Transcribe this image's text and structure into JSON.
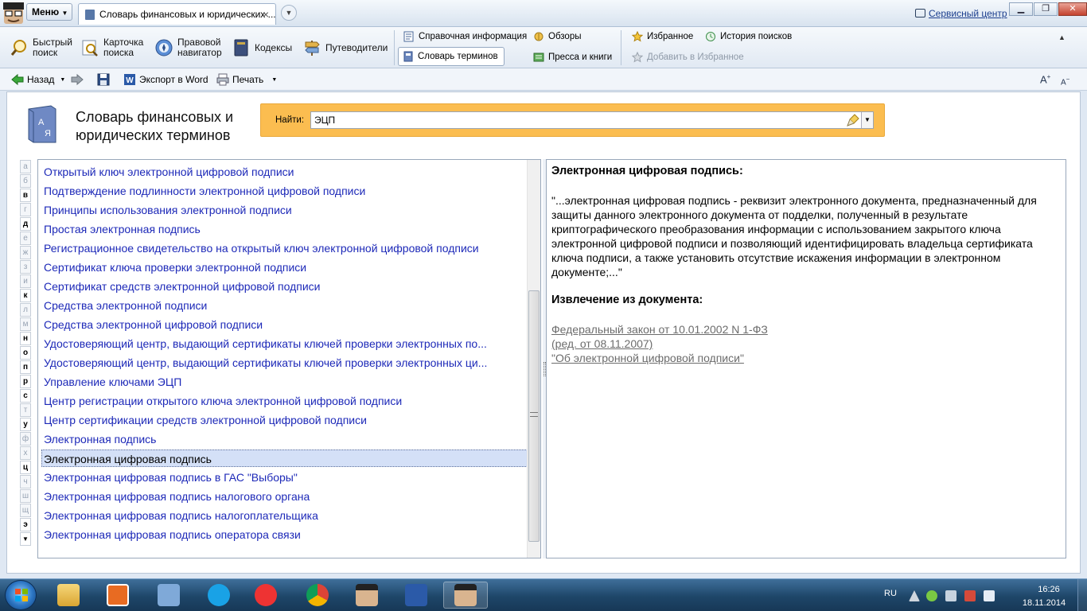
{
  "titlebar": {
    "menu_label": "Меню",
    "tab_title": "Словарь финансовых и юридических ...",
    "service_center": "Сервисный центр"
  },
  "ribbon": {
    "quick_search": "Быстрый\nпоиск",
    "search_card": "Карточка\nпоиска",
    "legal_navigator": "Правовой\nнавигатор",
    "codes": "Кодексы",
    "guides": "Путеводители",
    "reference_info": "Справочная информация",
    "reviews": "Обзоры",
    "dictionary": "Словарь терминов",
    "press_books": "Пресса и книги",
    "favorites": "Избранное",
    "search_history": "История поисков",
    "add_favorites": "Добавить в Избранное"
  },
  "toolbar": {
    "back": "Назад",
    "export_word": "Экспорт в Word",
    "print": "Печать"
  },
  "page": {
    "title": "Словарь финансовых и юридических терминов",
    "search_label": "Найти:",
    "search_value": "ЭЦП"
  },
  "alphabet": [
    {
      "letter": "а",
      "active": false
    },
    {
      "letter": "б",
      "active": false
    },
    {
      "letter": "в",
      "active": true
    },
    {
      "letter": "г",
      "active": false
    },
    {
      "letter": "д",
      "active": true
    },
    {
      "letter": "е",
      "active": false
    },
    {
      "letter": "ж",
      "active": false
    },
    {
      "letter": "з",
      "active": false
    },
    {
      "letter": "и",
      "active": false
    },
    {
      "letter": "к",
      "active": true
    },
    {
      "letter": "л",
      "active": false
    },
    {
      "letter": "м",
      "active": false
    },
    {
      "letter": "н",
      "active": true
    },
    {
      "letter": "о",
      "active": true
    },
    {
      "letter": "п",
      "active": true
    },
    {
      "letter": "р",
      "active": true
    },
    {
      "letter": "с",
      "active": true
    },
    {
      "letter": "т",
      "active": false
    },
    {
      "letter": "у",
      "active": true
    },
    {
      "letter": "ф",
      "active": false
    },
    {
      "letter": "х",
      "active": false
    },
    {
      "letter": "ц",
      "active": true
    },
    {
      "letter": "ч",
      "active": false
    },
    {
      "letter": "ш",
      "active": false
    },
    {
      "letter": "щ",
      "active": false
    },
    {
      "letter": "э",
      "active": true
    }
  ],
  "terms": [
    {
      "label": "Открытый ключ электронной цифровой подписи",
      "selected": false
    },
    {
      "label": "Подтверждение подлинности электронной цифровой подписи",
      "selected": false
    },
    {
      "label": "Принципы использования электронной подписи",
      "selected": false
    },
    {
      "label": "Простая электронная подпись",
      "selected": false
    },
    {
      "label": "Регистрационное свидетельство на открытый ключ электронной цифровой подписи",
      "selected": false
    },
    {
      "label": "Сертификат ключа проверки электронной подписи",
      "selected": false
    },
    {
      "label": "Сертификат средств электронной цифровой подписи",
      "selected": false
    },
    {
      "label": "Средства электронной подписи",
      "selected": false
    },
    {
      "label": "Средства электронной цифровой подписи",
      "selected": false
    },
    {
      "label": "Удостоверяющий центр, выдающий сертификаты ключей проверки электронных по...",
      "selected": false
    },
    {
      "label": "Удостоверяющий центр, выдающий сертификаты ключей проверки электронных ци...",
      "selected": false
    },
    {
      "label": "Управление ключами ЭЦП",
      "selected": false
    },
    {
      "label": "Центр регистрации открытого ключа электронной цифровой подписи",
      "selected": false
    },
    {
      "label": "Центр сертификации средств электронной цифровой подписи",
      "selected": false
    },
    {
      "label": "Электронная подпись",
      "selected": false
    },
    {
      "label": "Электронная цифровая подпись",
      "selected": true
    },
    {
      "label": "Электронная цифровая подпись в ГАС \"Выборы\"",
      "selected": false
    },
    {
      "label": "Электронная цифровая подпись налогового органа",
      "selected": false
    },
    {
      "label": "Электронная цифровая подпись налогоплательщика",
      "selected": false
    },
    {
      "label": "Электронная цифровая подпись оператора связи",
      "selected": false
    }
  ],
  "definition": {
    "title": "Электронная цифровая подпись:",
    "text": "\"...электронная цифровая подпись - реквизит электронного документа, предназначенный для защиты данного электронного документа от подделки, полученный в результате криптографического преобразования информации с использованием закрытого ключа электронной цифровой подписи и позволяющий идентифицировать владельца сертификата ключа подписи, а также установить отсутствие искажения информации в электронном документе;...\"",
    "excerpt_title": "Извлечение из документа:",
    "doc_line1": "Федеральный закон от 10.01.2002 N 1-ФЗ",
    "doc_line2": "(ред. от 08.11.2007)",
    "doc_line3": "\"Об электронной цифровой подписи\""
  },
  "taskbar": {
    "lang": "RU",
    "time": "16:26",
    "date": "18.11.2014"
  }
}
